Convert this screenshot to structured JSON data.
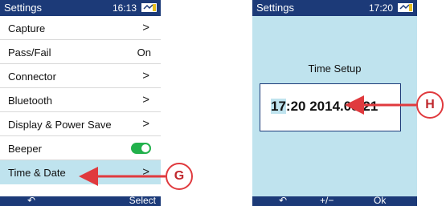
{
  "left_screen": {
    "status": {
      "title": "Settings",
      "time": "16:13",
      "battery_icon": "battery-icon"
    },
    "menu": [
      {
        "label": "Capture",
        "type": "chevron",
        "chevron": ">"
      },
      {
        "label": "Pass/Fail",
        "type": "value",
        "value": "On"
      },
      {
        "label": "Connector",
        "type": "chevron",
        "chevron": ">"
      },
      {
        "label": "Bluetooth",
        "type": "chevron",
        "chevron": ">"
      },
      {
        "label": "Display & Power Save",
        "type": "chevron",
        "chevron": ">"
      },
      {
        "label": "Beeper",
        "type": "toggle",
        "state": "on"
      },
      {
        "label": "Time & Date",
        "type": "chevron",
        "chevron": ">",
        "selected": true
      }
    ],
    "softkeys": {
      "left_icon": "back-arrow-icon",
      "left": "↶",
      "right": "Select"
    }
  },
  "right_screen": {
    "status": {
      "title": "Settings",
      "time": "17:20",
      "battery_icon": "battery-icon"
    },
    "heading": "Time Setup",
    "time_value": {
      "cursor": "17",
      "rest": ":20 2014.03.21"
    },
    "softkeys": {
      "left_icon": "back-arrow-icon",
      "left": "↶",
      "middle": "+/−",
      "right": "Ok"
    }
  },
  "callouts": {
    "g": "G",
    "h": "H"
  },
  "colors": {
    "header": "#1c3a78",
    "highlight": "#bfe3ee",
    "toggle": "#22b14c",
    "callout": "#e03a3e"
  }
}
